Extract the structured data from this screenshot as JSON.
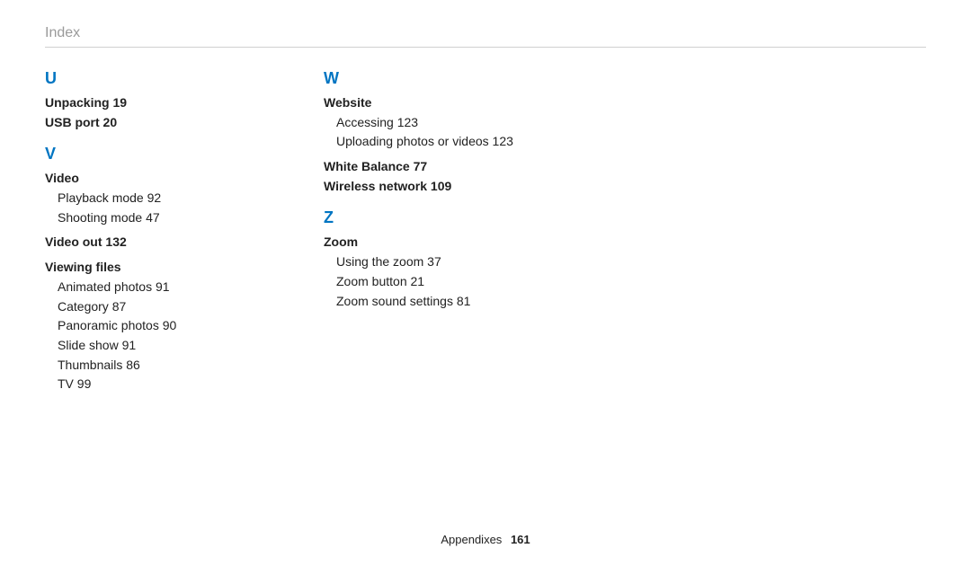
{
  "header": "Index",
  "footer": {
    "section": "Appendixes",
    "page": "161"
  },
  "col1": {
    "letterU": "U",
    "unpacking": "Unpacking  19",
    "usbport": "USB port  20",
    "letterV": "V",
    "video": "Video",
    "video_playback": "Playback mode  92",
    "video_shooting": "Shooting mode  47",
    "videoout": "Video out  132",
    "viewingfiles": "Viewing files",
    "vf_animated": "Animated photos  91",
    "vf_category": "Category  87",
    "vf_panoramic": "Panoramic photos  90",
    "vf_slideshow": "Slide show  91",
    "vf_thumbnails": "Thumbnails  86",
    "vf_tv": "TV  99"
  },
  "col2": {
    "letterW": "W",
    "website": "Website",
    "ws_accessing": "Accessing  123",
    "ws_uploading": "Uploading photos or videos  123",
    "whitebalance": "White Balance  77",
    "wireless": "Wireless network  109",
    "letterZ": "Z",
    "zoom": "Zoom",
    "z_using": "Using the zoom  37",
    "z_button": "Zoom button  21",
    "z_sound": "Zoom sound settings  81"
  },
  "chart_data": {
    "type": "table",
    "title": "Index",
    "entries": [
      {
        "letter": "U",
        "term": "Unpacking",
        "page": 19
      },
      {
        "letter": "U",
        "term": "USB port",
        "page": 20
      },
      {
        "letter": "V",
        "term": "Video",
        "sub": "Playback mode",
        "page": 92
      },
      {
        "letter": "V",
        "term": "Video",
        "sub": "Shooting mode",
        "page": 47
      },
      {
        "letter": "V",
        "term": "Video out",
        "page": 132
      },
      {
        "letter": "V",
        "term": "Viewing files",
        "sub": "Animated photos",
        "page": 91
      },
      {
        "letter": "V",
        "term": "Viewing files",
        "sub": "Category",
        "page": 87
      },
      {
        "letter": "V",
        "term": "Viewing files",
        "sub": "Panoramic photos",
        "page": 90
      },
      {
        "letter": "V",
        "term": "Viewing files",
        "sub": "Slide show",
        "page": 91
      },
      {
        "letter": "V",
        "term": "Viewing files",
        "sub": "Thumbnails",
        "page": 86
      },
      {
        "letter": "V",
        "term": "Viewing files",
        "sub": "TV",
        "page": 99
      },
      {
        "letter": "W",
        "term": "Website",
        "sub": "Accessing",
        "page": 123
      },
      {
        "letter": "W",
        "term": "Website",
        "sub": "Uploading photos or videos",
        "page": 123
      },
      {
        "letter": "W",
        "term": "White Balance",
        "page": 77
      },
      {
        "letter": "W",
        "term": "Wireless network",
        "page": 109
      },
      {
        "letter": "Z",
        "term": "Zoom",
        "sub": "Using the zoom",
        "page": 37
      },
      {
        "letter": "Z",
        "term": "Zoom",
        "sub": "Zoom button",
        "page": 21
      },
      {
        "letter": "Z",
        "term": "Zoom",
        "sub": "Zoom sound settings",
        "page": 81
      }
    ]
  }
}
